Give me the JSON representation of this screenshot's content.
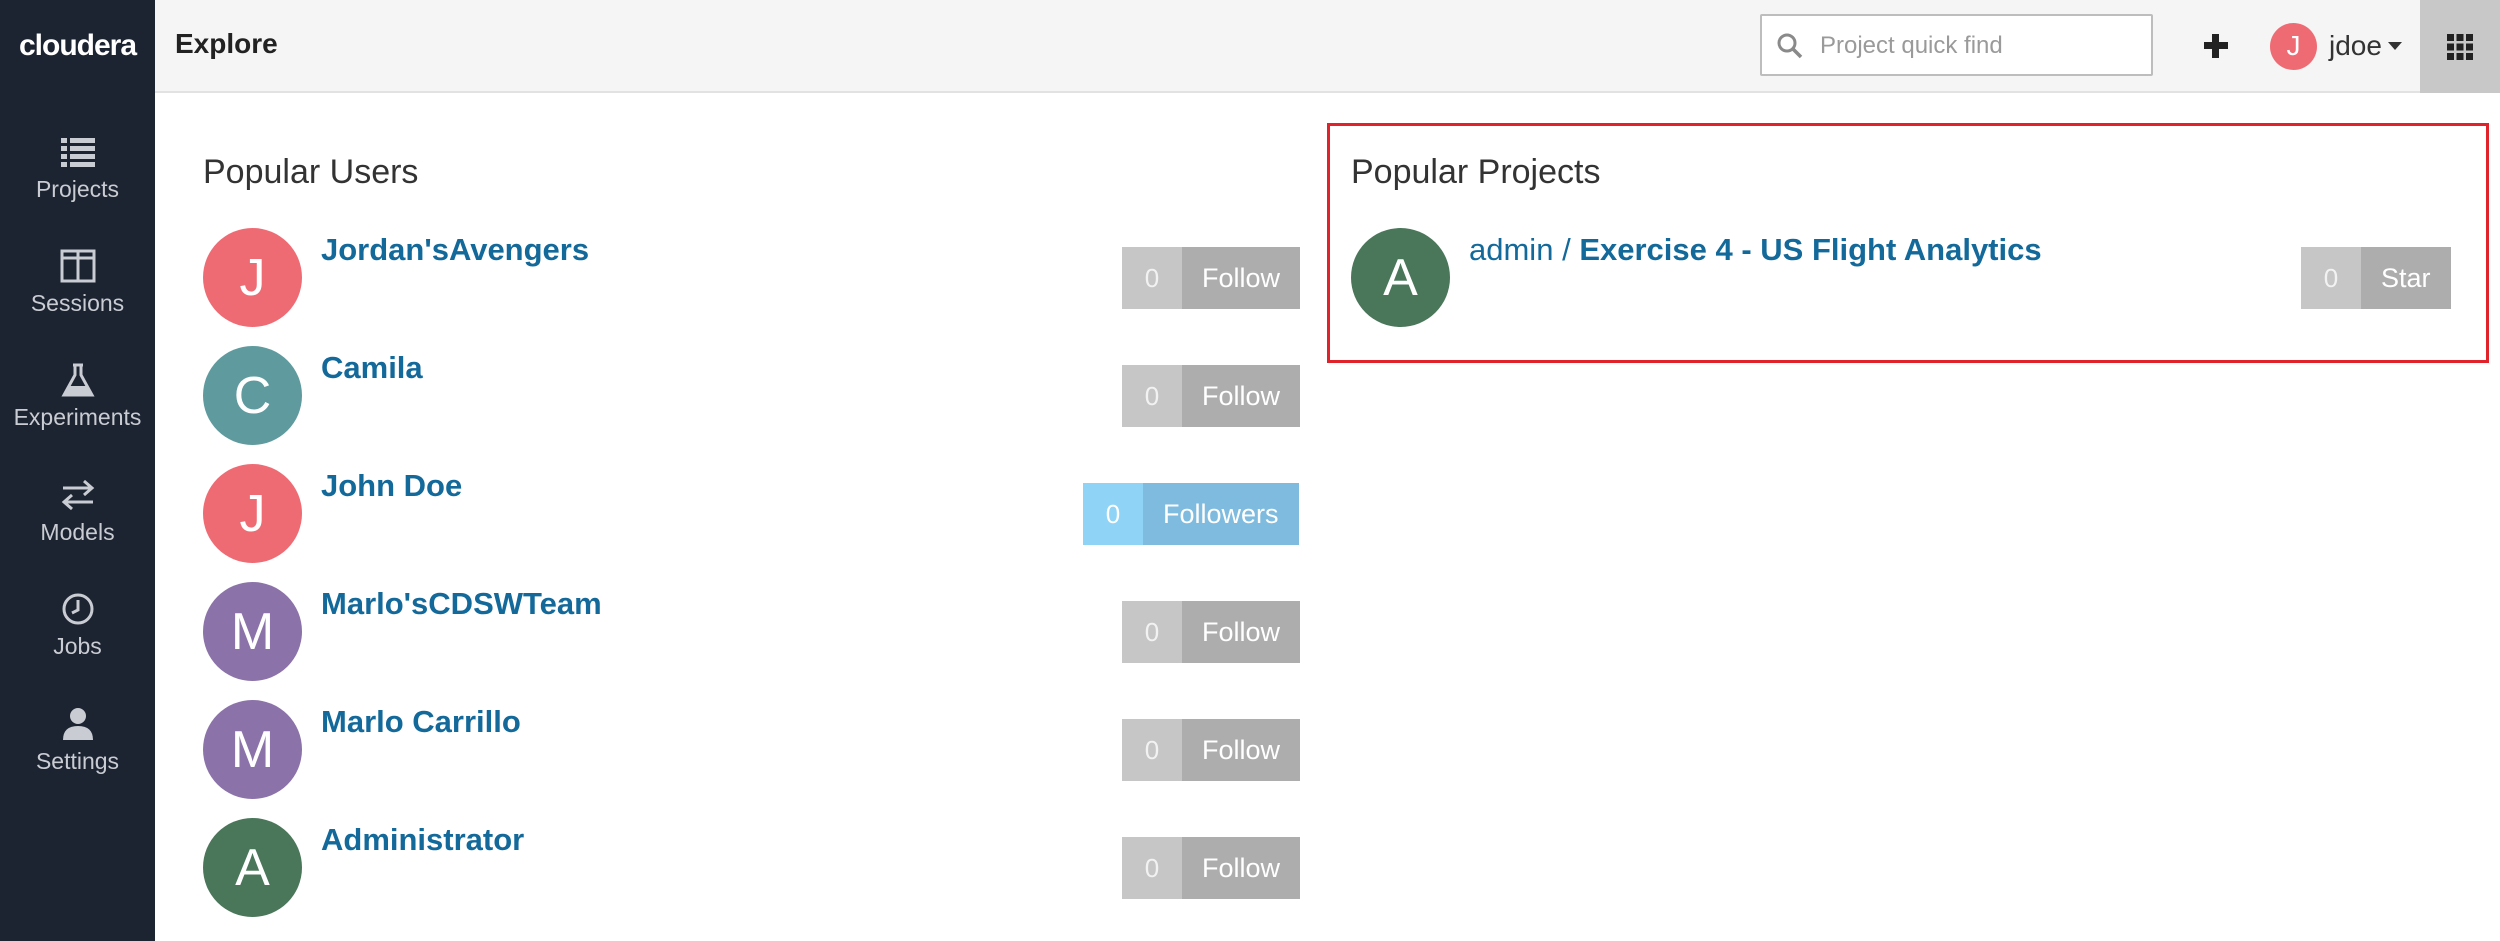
{
  "sidebar": {
    "brand": "cloudera",
    "items": [
      {
        "label": "Projects",
        "icon": "list-icon"
      },
      {
        "label": "Sessions",
        "icon": "columns-icon"
      },
      {
        "label": "Experiments",
        "icon": "flask-icon"
      },
      {
        "label": "Models",
        "icon": "arrows-icon"
      },
      {
        "label": "Jobs",
        "icon": "clock-icon"
      },
      {
        "label": "Settings",
        "icon": "user-icon"
      }
    ]
  },
  "header": {
    "title": "Explore",
    "search_placeholder": "Project quick find",
    "user": {
      "initial": "J",
      "name": "jdoe"
    }
  },
  "popular_users": {
    "title": "Popular Users",
    "users": [
      {
        "name": "Jordan'sAvengers",
        "initial": "J",
        "count": "0",
        "action": "Follow",
        "color": "#ef6b74"
      },
      {
        "name": "Camila",
        "initial": "C",
        "count": "0",
        "action": "Follow",
        "color": "#5e9a9e"
      },
      {
        "name": "John Doe",
        "initial": "J",
        "count": "0",
        "action": "Followers",
        "color": "#ef6b74"
      },
      {
        "name": "Marlo'sCDSWTeam",
        "initial": "M",
        "count": "0",
        "action": "Follow",
        "color": "#8b72a8"
      },
      {
        "name": "Marlo Carrillo",
        "initial": "M",
        "count": "0",
        "action": "Follow",
        "color": "#8b72a8"
      },
      {
        "name": "Administrator",
        "initial": "A",
        "count": "0",
        "action": "Follow",
        "color": "#4a765a"
      }
    ]
  },
  "popular_projects": {
    "title": "Popular Projects",
    "projects": [
      {
        "owner": "admin",
        "separator": "/",
        "name": "Exercise 4 - US Flight Analytics",
        "initial": "A",
        "count": "0",
        "action": "Star",
        "color": "#4a765a"
      }
    ]
  },
  "colors": {
    "sidebar_bg": "#1c2331",
    "link": "#13699a",
    "highlight": "#e0222b"
  }
}
